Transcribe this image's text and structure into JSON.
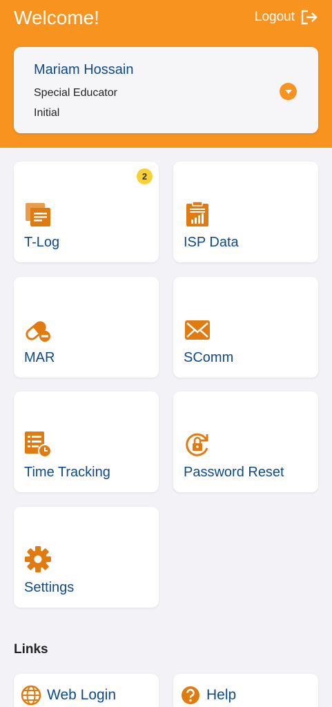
{
  "header": {
    "title": "Welcome!",
    "logout_label": "Logout"
  },
  "profile": {
    "name": "Mariam Hossain",
    "role": "Special Educator",
    "status": "Initial"
  },
  "tiles": [
    {
      "label": "T-Log",
      "icon": "tlog-icon",
      "badge": "2"
    },
    {
      "label": "ISP Data",
      "icon": "isp-data-icon"
    },
    {
      "label": "MAR",
      "icon": "pill-icon"
    },
    {
      "label": "SComm",
      "icon": "envelope-icon"
    },
    {
      "label": "Time Tracking",
      "icon": "time-tracking-icon"
    },
    {
      "label": "Password Reset",
      "icon": "password-reset-icon"
    },
    {
      "label": "Settings",
      "icon": "gear-icon"
    }
  ],
  "links": {
    "title": "Links",
    "items": [
      {
        "label": "Web Login",
        "icon": "globe-icon"
      },
      {
        "label": "Help",
        "icon": "help-icon"
      }
    ]
  },
  "colors": {
    "accent": "#f7931e",
    "icon_orange": "#e07b12",
    "text_blue": "#0d4a8a",
    "background": "#f2f2f7",
    "badge": "#f7d035"
  }
}
